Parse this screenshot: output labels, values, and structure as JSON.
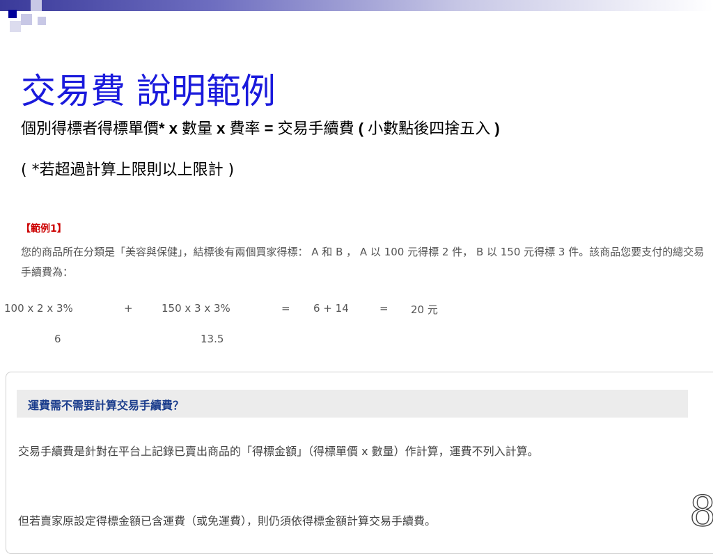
{
  "slide": {
    "title": "交易費 說明範例",
    "formula": {
      "part1": "個別得標者得標單價",
      "star": "* x ",
      "part2": "數量",
      "x2": " x ",
      "part3": "費率",
      "eq": " = ",
      "part4": "交易手續費",
      "open": " ( ",
      "part5": "小數點後四捨五入",
      "close": " )"
    },
    "note": "( *若超過計算上限則以上限計 )",
    "page_number": "8"
  },
  "example": {
    "heading": "【範例1】",
    "body": "您的商品所在分類是「美容與保健」，結標後有兩個買家得標： A 和 B ， A 以 100 元得標 2 件， B 以 150 元得標 3 件。該商品您要支付的總交易手續費為：",
    "calc": {
      "term1": "100 x 2 x 3%",
      "plus": "+",
      "term2": "150 x 3 x 3%",
      "eq1": "=",
      "sum": "6 + 14",
      "eq2": "=",
      "result": "20 元",
      "result1": "6",
      "result2": "13.5"
    }
  },
  "faq": {
    "question": "運費需不需要計算交易手續費？",
    "answer1": "交易手續費是針對在平台上記錄已賣出商品的「得標金額」（得標單價 x 數量）作計算，運費不列入計算。",
    "answer2": "但若賣家原設定得標金額已含運費（或免運費），則仍須依得標金額計算交易手續費。"
  }
}
